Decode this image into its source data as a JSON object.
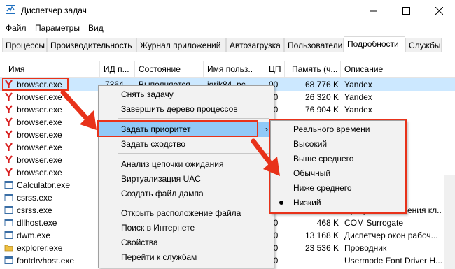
{
  "window": {
    "title": "Диспетчер задач"
  },
  "colors": {
    "selection": "#cce8ff",
    "menu_highlight": "#91c9f7",
    "annotation_red": "#e8321a",
    "yandex_red": "#d81f1f"
  },
  "menubar": {
    "items": [
      "Файл",
      "Параметры",
      "Вид"
    ]
  },
  "tabs": [
    "Процессы",
    "Производительность",
    "Журнал приложений",
    "Автозагрузка",
    "Пользователи",
    "Подробности",
    "Службы"
  ],
  "active_tab": "Подробности",
  "columns": [
    "Имя",
    "ИД п...",
    "Состояние",
    "Имя польз...",
    "ЦП",
    "Память (ч...",
    "Описание"
  ],
  "rows": [
    {
      "name": "browser.exe",
      "pid": "7364",
      "state": "Выполняется",
      "user": "igrik84_pc",
      "cpu": "00",
      "mem": "68 776 K",
      "desc": "Yandex",
      "icon": "yandex-icon"
    },
    {
      "name": "browser.exe",
      "pid": "",
      "state": "",
      "user": "",
      "cpu": "00",
      "mem": "26 320 K",
      "desc": "Yandex",
      "icon": "yandex-icon"
    },
    {
      "name": "browser.exe",
      "pid": "",
      "state": "",
      "user": "",
      "cpu": "00",
      "mem": "76 904 K",
      "desc": "Yandex",
      "icon": "yandex-icon"
    },
    {
      "name": "browser.exe",
      "pid": "",
      "state": "",
      "user": "",
      "cpu": "",
      "mem": "",
      "desc": "",
      "icon": "yandex-icon"
    },
    {
      "name": "browser.exe",
      "pid": "",
      "state": "",
      "user": "",
      "cpu": "",
      "mem": "",
      "desc": "",
      "icon": "yandex-icon"
    },
    {
      "name": "browser.exe",
      "pid": "",
      "state": "",
      "user": "",
      "cpu": "",
      "mem": "",
      "desc": "",
      "icon": "yandex-icon"
    },
    {
      "name": "browser.exe",
      "pid": "",
      "state": "",
      "user": "",
      "cpu": "",
      "mem": "",
      "desc": "",
      "icon": "yandex-icon"
    },
    {
      "name": "browser.exe",
      "pid": "",
      "state": "",
      "user": "",
      "cpu": "",
      "mem": "",
      "desc": "",
      "icon": "yandex-icon"
    },
    {
      "name": "Calculator.exe",
      "pid": "",
      "state": "",
      "user": "",
      "cpu": "",
      "mem": "",
      "desc": "",
      "icon": "app-icon"
    },
    {
      "name": "csrss.exe",
      "pid": "",
      "state": "",
      "user": "",
      "cpu": "",
      "mem": "",
      "desc": "",
      "icon": "app-icon"
    },
    {
      "name": "csrss.exe",
      "pid": "",
      "state": "",
      "user": "",
      "cpu": "",
      "mem": "",
      "desc": "Процесс исполнения кл...",
      "icon": "app-icon"
    },
    {
      "name": "dllhost.exe",
      "pid": "",
      "state": "",
      "user": "",
      "cpu": "00",
      "mem": "468 K",
      "desc": "COM Surrogate",
      "icon": "app-icon"
    },
    {
      "name": "dwm.exe",
      "pid": "",
      "state": "",
      "user": "",
      "cpu": "00",
      "mem": "13 168 K",
      "desc": "Диспетчер окон рабоч...",
      "icon": "app-icon"
    },
    {
      "name": "explorer.exe",
      "pid": "",
      "state": "",
      "user": "",
      "cpu": "00",
      "mem": "23 536 K",
      "desc": "Проводник",
      "icon": "folder-icon"
    },
    {
      "name": "fontdrvhost.exe",
      "pid": "",
      "state": "",
      "user": "",
      "cpu": "00",
      "mem": "",
      "desc": "Usermode Font Driver H...",
      "icon": "app-icon"
    }
  ],
  "context_menu": {
    "items": [
      {
        "label": "Снять задачу"
      },
      {
        "label": "Завершить дерево процессов"
      },
      {
        "label": "Задать приоритет",
        "submenu": true
      },
      {
        "label": "Задать сходство"
      },
      {
        "label": "Анализ цепочки ожидания"
      },
      {
        "label": "Виртуализация UAC"
      },
      {
        "label": "Создать файл дампа"
      },
      {
        "label": "Открыть расположение файла"
      },
      {
        "label": "Поиск в Интернете"
      },
      {
        "label": "Свойства"
      },
      {
        "label": "Перейти к службам"
      }
    ],
    "submenu_arrow": "›"
  },
  "priority_menu": {
    "items": [
      "Реального времени",
      "Высокий",
      "Выше среднего",
      "Обычный",
      "Ниже среднего",
      "Низкий"
    ],
    "checked": "Низкий"
  }
}
